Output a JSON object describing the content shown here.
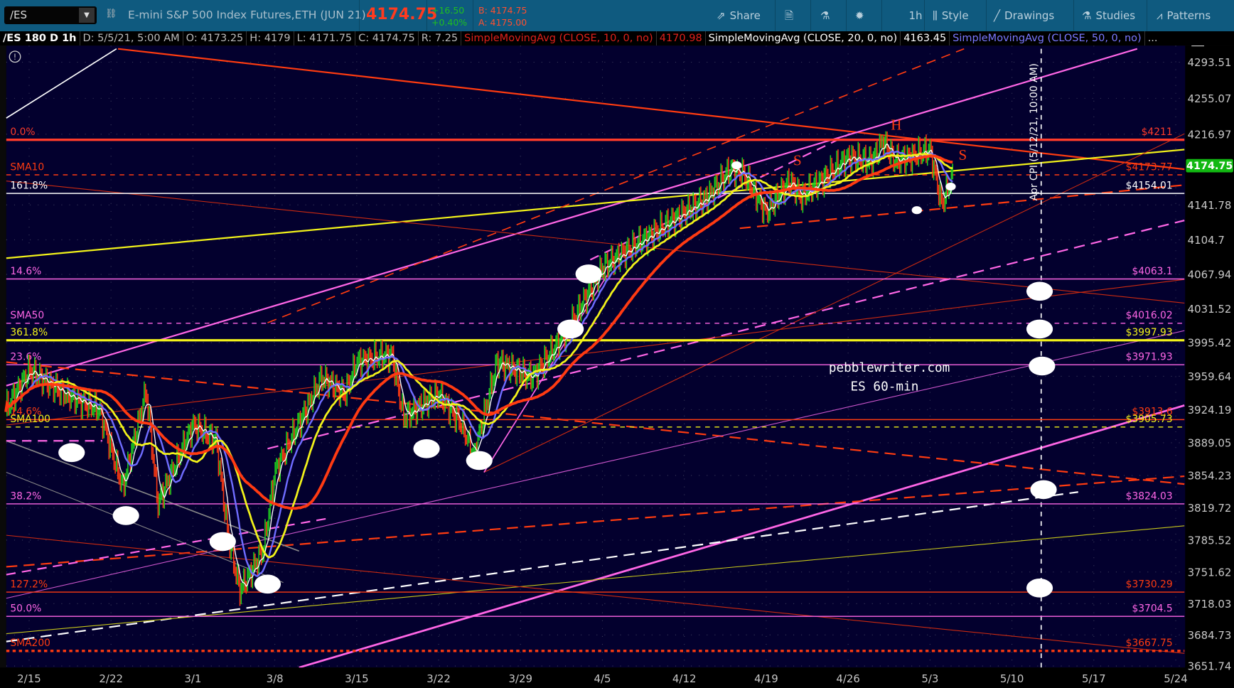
{
  "toolbar": {
    "symbol": "/ES",
    "instrument": "E-mini S&P 500 Index Futures,ETH (JUN 21)",
    "last_price": "4174.75",
    "change": "+16.50",
    "change_pct": "+0.40%",
    "bid": "B: 4174.75",
    "ask": "A: 4175.00",
    "share_label": "Share",
    "timeframe_label": "1h",
    "style_label": "Style",
    "drawings_label": "Drawings",
    "studies_label": "Studies",
    "patterns_label": "Patterns"
  },
  "infobar": {
    "chart_spec": "/ES 180 D 1h",
    "date": "D: 5/5/21, 5:00 AM",
    "open": "O: 4173.25",
    "high": "H: 4179",
    "low": "L: 4171.75",
    "close": "C: 4174.75",
    "range": "R: 7.25",
    "sma10_label": "SimpleMovingAvg (CLOSE, 10, 0, no)",
    "sma10_value": "4170.98",
    "sma20_label": "SimpleMovingAvg (CLOSE, 20, 0, no)",
    "sma20_value": "4163.45",
    "sma50_label": "SimpleMovingAvg (CLOSE, 50, 0, no)",
    "more": "..."
  },
  "colors": {
    "toolbar_bg": "#0f5a7f",
    "chart_bg": "#03002e",
    "up": "#1fd11f",
    "down": "#ff3a12",
    "sma_short": "#ffffff",
    "sma_mid": "#6f6cff",
    "sma_long": "#f2f21a",
    "sma_slow": "#ff3a12",
    "price_tag": "#12b812"
  },
  "chart_data": {
    "type": "candlestick",
    "price_tag": "4174.75",
    "y_ticks": [
      "4293.51",
      "4255.07",
      "4216.97",
      "4141.78",
      "4104.7",
      "4067.94",
      "4031.52",
      "3995.42",
      "3959.64",
      "3924.19",
      "3889.05",
      "3854.23",
      "3819.72",
      "3785.52",
      "3751.62",
      "3718.03",
      "3684.73",
      "3651.74"
    ],
    "ylim": [
      3651.74,
      4293.51
    ],
    "x_ticks": [
      "2/15",
      "2/22",
      "3/1",
      "3/8",
      "3/15",
      "3/22",
      "3/29",
      "4/5",
      "4/12",
      "4/19",
      "4/26",
      "5/3",
      "5/10",
      "5/17",
      "5/24"
    ],
    "price_path": [
      [
        "2/13",
        3924
      ],
      [
        "2/15",
        3966
      ],
      [
        "2/18",
        3941
      ],
      [
        "2/21",
        3924
      ],
      [
        "2/23",
        3841
      ],
      [
        "2/25",
        3945
      ],
      [
        "2/26",
        3824
      ],
      [
        "3/1",
        3908
      ],
      [
        "3/3",
        3891
      ],
      [
        "3/4",
        3790
      ],
      [
        "3/5",
        3732
      ],
      [
        "3/7",
        3774
      ],
      [
        "3/8",
        3858
      ],
      [
        "3/10",
        3908
      ],
      [
        "3/12",
        3958
      ],
      [
        "3/14",
        3941
      ],
      [
        "3/15",
        3975
      ],
      [
        "3/18",
        3983
      ],
      [
        "3/19",
        3916
      ],
      [
        "3/22",
        3941
      ],
      [
        "3/24",
        3908
      ],
      [
        "3/25",
        3874
      ],
      [
        "3/27",
        3975
      ],
      [
        "3/30",
        3958
      ],
      [
        "4/2",
        4008
      ],
      [
        "4/5",
        4075
      ],
      [
        "4/7",
        4092
      ],
      [
        "4/10",
        4117
      ],
      [
        "4/14",
        4150
      ],
      [
        "4/16",
        4180
      ],
      [
        "4/17",
        4175
      ],
      [
        "4/19",
        4134
      ],
      [
        "4/21",
        4167
      ],
      [
        "4/22",
        4150
      ],
      [
        "4/26",
        4192
      ],
      [
        "4/28",
        4188
      ],
      [
        "4/29",
        4209
      ],
      [
        "4/30",
        4188
      ],
      [
        "5/3",
        4200
      ],
      [
        "5/4",
        4142
      ],
      [
        "5/5",
        4175
      ]
    ],
    "levels": [
      {
        "price": 4211,
        "left": "0.0%",
        "right": "$4211",
        "color": "#ff3b2a",
        "style": "thick"
      },
      {
        "price": 4173.77,
        "left": "SMA10",
        "right": "$4173.77",
        "color": "#ff3b10",
        "style": "dash"
      },
      {
        "price": 4154.01,
        "left": "161.8%",
        "right": "$4154.01",
        "color": "#ffffff",
        "style": "solid"
      },
      {
        "price": 4063.1,
        "left": "14.6%",
        "right": "$4063.1",
        "color": "#ff66e6",
        "style": "solid"
      },
      {
        "price": 4016.02,
        "left": "SMA50",
        "right": "$4016.02",
        "color": "#ff66e6",
        "style": "dash"
      },
      {
        "price": 3997.93,
        "left": "361.8%",
        "right": "$3997.93",
        "color": "#f2f21a",
        "style": "thick"
      },
      {
        "price": 3971.93,
        "left": "23.6%",
        "right": "$3971.93",
        "color": "#ff66e6",
        "style": "solid"
      },
      {
        "price": 3913.6,
        "left": "14.6%",
        "right": "$3913.6",
        "color": "#ff3b10",
        "style": "solid"
      },
      {
        "price": 3905.73,
        "left": "SMA100",
        "right": "$3905.73",
        "color": "#f2f21a",
        "style": "dash"
      },
      {
        "price": 3824.03,
        "left": "38.2%",
        "right": "$3824.03",
        "color": "#ff66e6",
        "style": "solid"
      },
      {
        "price": 3730.29,
        "left": "127.2%",
        "right": "$3730.29",
        "color": "#ff3b10",
        "style": "solid"
      },
      {
        "price": 3704.5,
        "left": "50.0%",
        "right": "$3704.5",
        "color": "#ff66e6",
        "style": "solid"
      },
      {
        "price": 3667.75,
        "left": "SMA200",
        "right": "$3667.75",
        "color": "#ff3b10",
        "style": "dot"
      }
    ],
    "annotations": {
      "event": "Apr CPI (5/12/21, 10:00 AM)",
      "watermark_1": "pebblewriter.com",
      "watermark_2": "ES 60-min",
      "head": "H",
      "shoulder_left": "S",
      "shoulder_right": "S"
    }
  }
}
